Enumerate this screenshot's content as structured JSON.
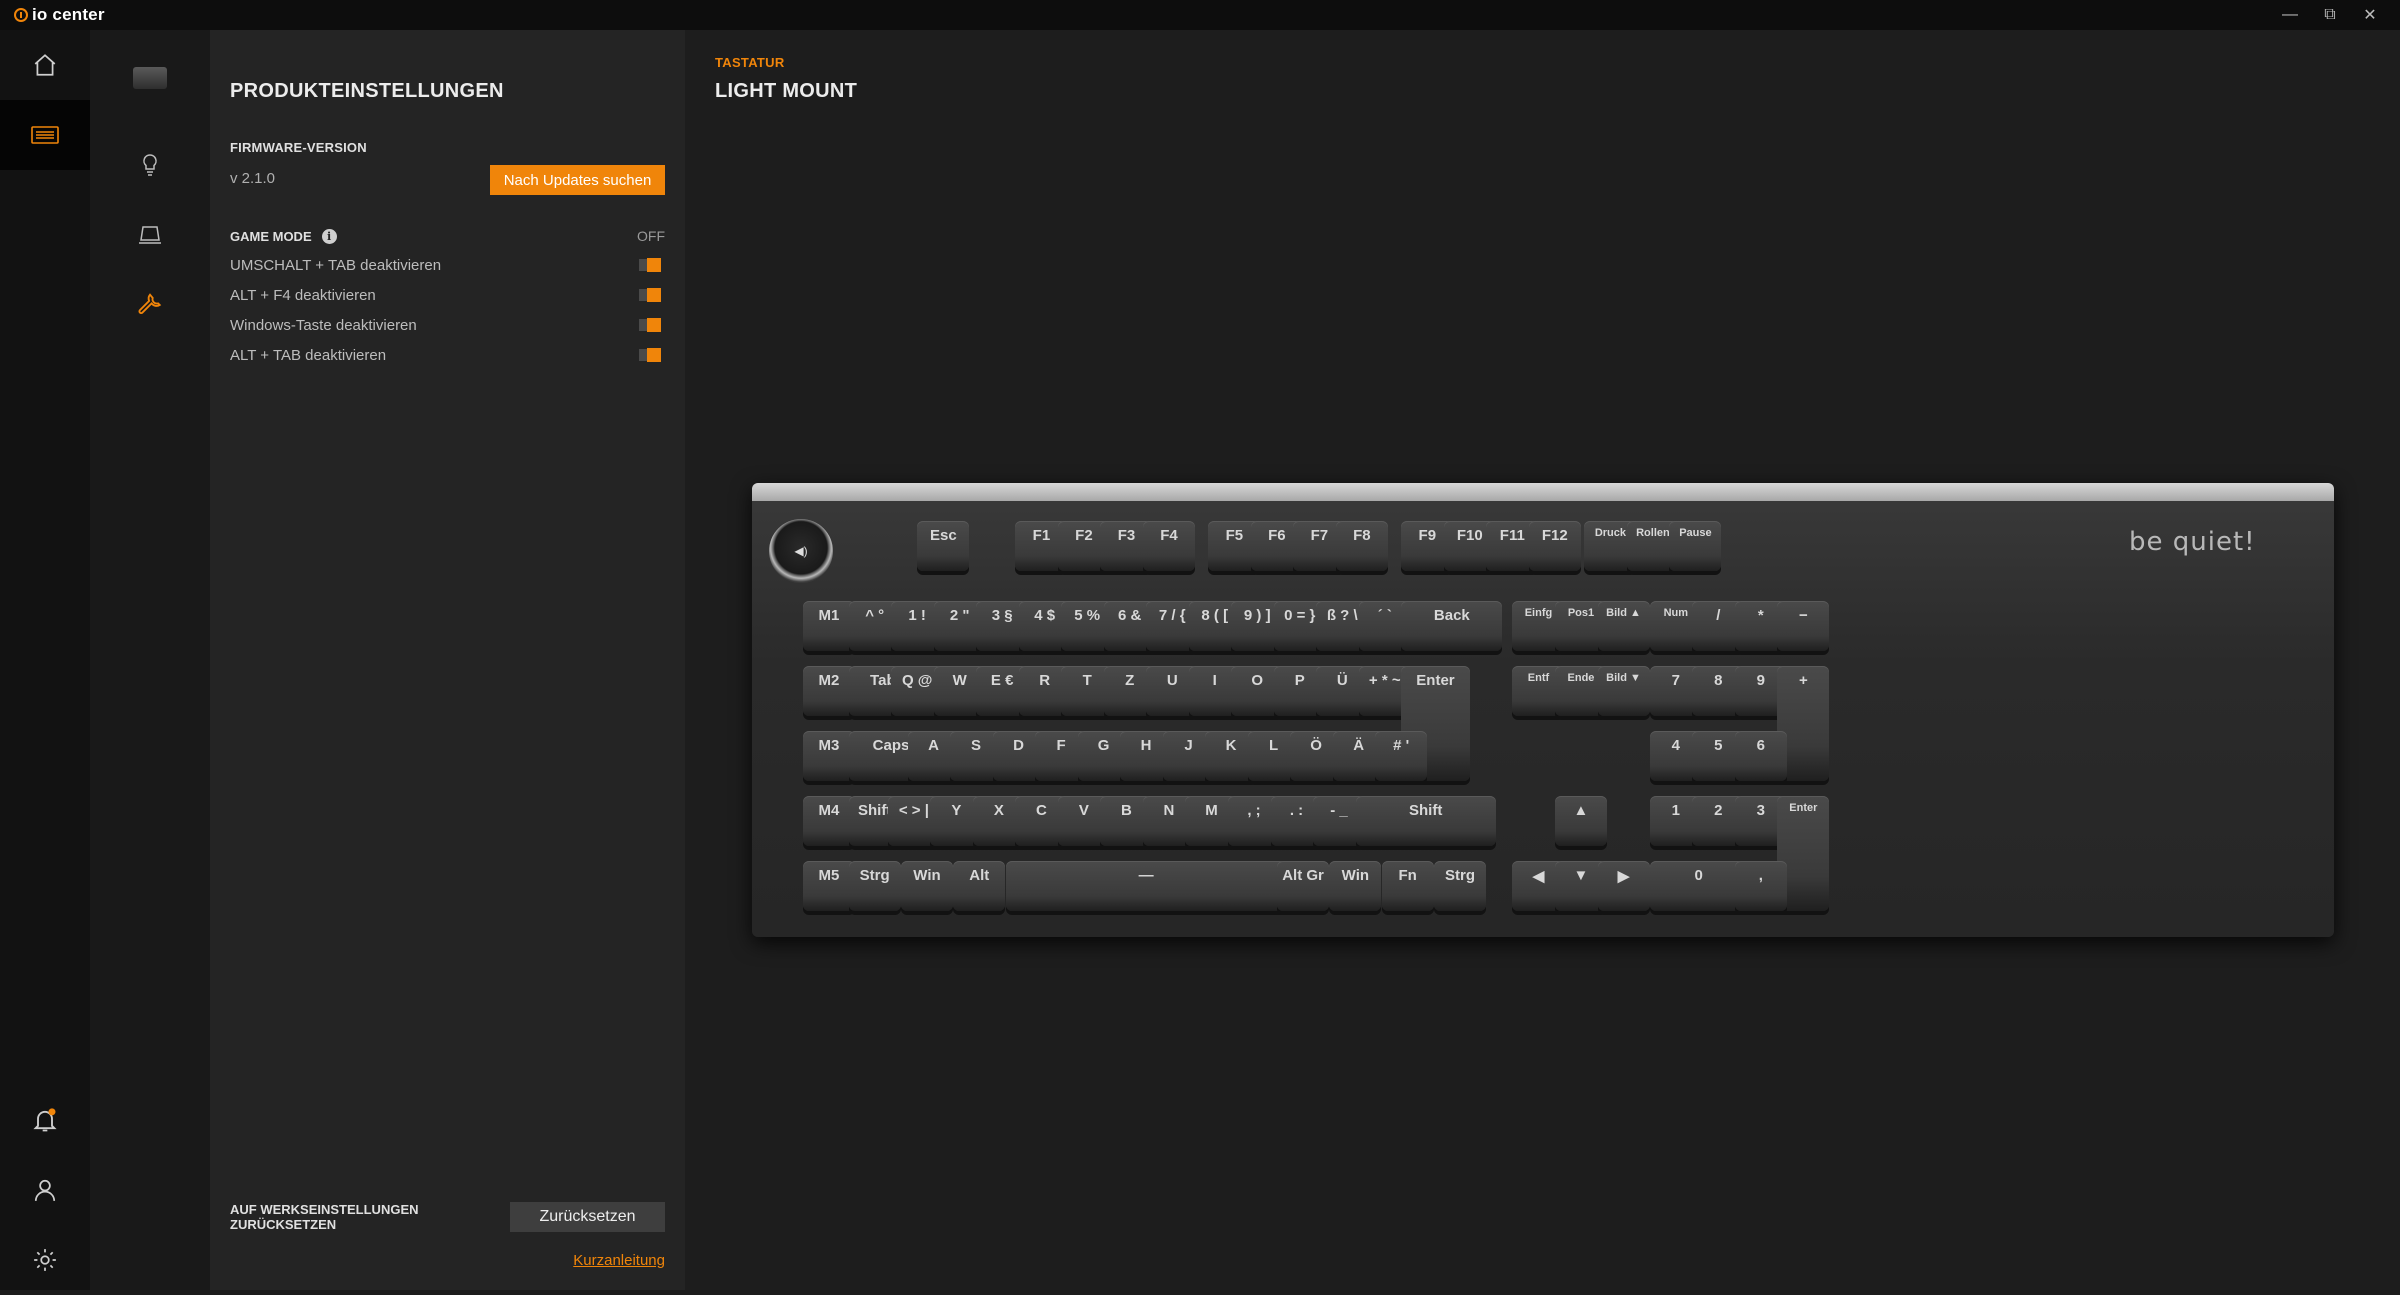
{
  "app": {
    "name": "io center"
  },
  "window": {
    "minimize": "—",
    "restore": "⧉",
    "close": "✕"
  },
  "rail": [
    {
      "name": "home-icon"
    },
    {
      "name": "keyboard-icon",
      "active": true
    },
    {
      "name": "bell-icon"
    },
    {
      "name": "user-icon"
    },
    {
      "name": "settings-gear-icon"
    }
  ],
  "subnav": [
    {
      "name": "device-thumbnail-icon"
    },
    {
      "name": "lightbulb-icon"
    },
    {
      "name": "profile-icon"
    },
    {
      "name": "wrench-icon",
      "active": true
    }
  ],
  "settings": {
    "title": "PRODUKTEINSTELLUNGEN",
    "firmware_label": "FIRMWARE-VERSION",
    "firmware_version": "v 2.1.0",
    "update_button": "Nach Updates suchen",
    "game_mode_label": "GAME MODE",
    "game_mode_state": "OFF",
    "options": [
      {
        "label": "UMSCHALT + TAB deaktivieren",
        "enabled": true
      },
      {
        "label": "ALT + F4 deaktivieren",
        "enabled": true
      },
      {
        "label": "Windows-Taste deaktivieren",
        "enabled": true
      },
      {
        "label": "ALT + TAB deaktivieren",
        "enabled": true
      }
    ],
    "reset_label_line1": "AUF WERKSEINSTELLUNGEN",
    "reset_label_line2": "ZURÜCKSETZEN",
    "reset_button": "Zurücksetzen",
    "quick_guide_link": "Kurzanleitung"
  },
  "main": {
    "breadcrumb": "TASTATUR",
    "title": "LIGHT MOUNT",
    "brand_logo": "be quiet!"
  },
  "keyboard": {
    "knob_label": "◀)",
    "keys": [
      "Esc",
      "F1",
      "F2",
      "F3",
      "F4",
      "F5",
      "F6",
      "F7",
      "F8",
      "F9",
      "F10",
      "F11",
      "F12",
      "Druck",
      "Rollen",
      "Pause",
      "M1",
      "^ °",
      "1 !",
      "2 \"",
      "3 §",
      "4 $",
      "5 %",
      "6 &",
      "7 / {",
      "8 ( [",
      "9 ) ]",
      "0 = }",
      "ß ? \\",
      "´ `",
      "Back",
      "Einfg",
      "Pos1",
      "Bild ▲",
      "Num",
      "/",
      "*",
      "−",
      "M2",
      "Tab",
      "Q @",
      "W",
      "E €",
      "R",
      "T",
      "Z",
      "U",
      "I",
      "O",
      "P",
      "Ü",
      "+ * ~",
      "Enter",
      "Entf",
      "Ende",
      "Bild ▼",
      "7",
      "8",
      "9",
      "+",
      "M3",
      "Caps",
      "A",
      "S",
      "D",
      "F",
      "G",
      "H",
      "J",
      "K",
      "L",
      "Ö",
      "Ä",
      "# '",
      "4",
      "5",
      "6",
      "M4",
      "Shift",
      "< > |",
      "Y",
      "X",
      "C",
      "V",
      "B",
      "N",
      "M",
      ", ;",
      ". :",
      "- _",
      "Shift",
      "▲",
      "1",
      "2",
      "3",
      "Enter",
      "M5",
      "Strg",
      "Win",
      "Alt",
      "—",
      "Alt Gr",
      "Win",
      "Fn",
      "Strg",
      "◀",
      "▼",
      "▶",
      "0",
      ","
    ]
  }
}
